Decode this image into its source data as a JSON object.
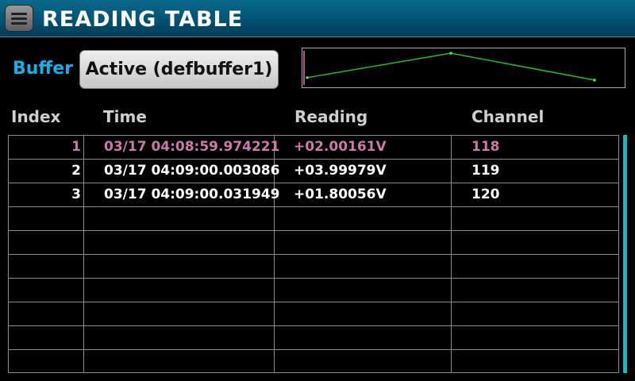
{
  "header": {
    "title": "READING TABLE"
  },
  "buffer": {
    "label": "Buffer",
    "selected": "Active (defbuffer1)"
  },
  "table": {
    "columns": [
      "Index",
      "Time",
      "Reading",
      "Channel"
    ],
    "rows": [
      {
        "index": "1",
        "time": "03/17 04:08:59.974221",
        "reading": "+02.00161V",
        "channel": "118",
        "highlight": true
      },
      {
        "index": "2",
        "time": "03/17 04:09:00.003086",
        "reading": "+03.99979V",
        "channel": "119",
        "highlight": false
      },
      {
        "index": "3",
        "time": "03/17 04:09:00.031949",
        "reading": "+01.80056V",
        "channel": "120",
        "highlight": false
      }
    ],
    "empty_rows": 7
  },
  "mini_graph": {
    "readings": [
      2.00161,
      3.99979,
      1.80056
    ],
    "line_color": "#22c022",
    "cursor_color": "#c0508a"
  },
  "colors": {
    "accent": "#18aee6",
    "highlight_row": "#c87aa8",
    "scrollbar": "#16b7c0"
  }
}
